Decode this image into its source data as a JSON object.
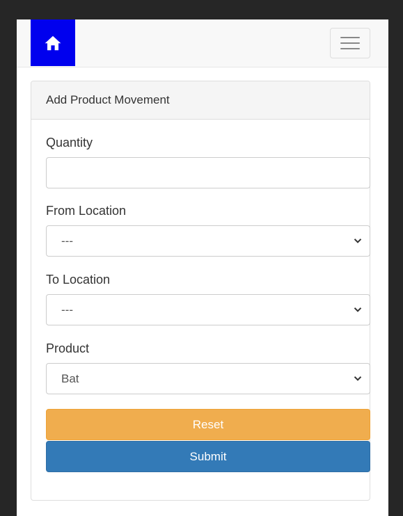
{
  "colors": {
    "home_button_bg": "#0000ee",
    "warning": "#f0ad4e",
    "primary": "#337ab7"
  },
  "navbar": {
    "home_icon": "home-icon",
    "menu_icon": "hamburger-menu-icon"
  },
  "panel": {
    "title": "Add Product Movement"
  },
  "form": {
    "quantity": {
      "label": "Quantity",
      "value": ""
    },
    "from_location": {
      "label": "From Location",
      "selected": "---"
    },
    "to_location": {
      "label": "To Location",
      "selected": "---"
    },
    "product": {
      "label": "Product",
      "selected": "Bat"
    },
    "reset_label": "Reset",
    "submit_label": "Submit"
  }
}
